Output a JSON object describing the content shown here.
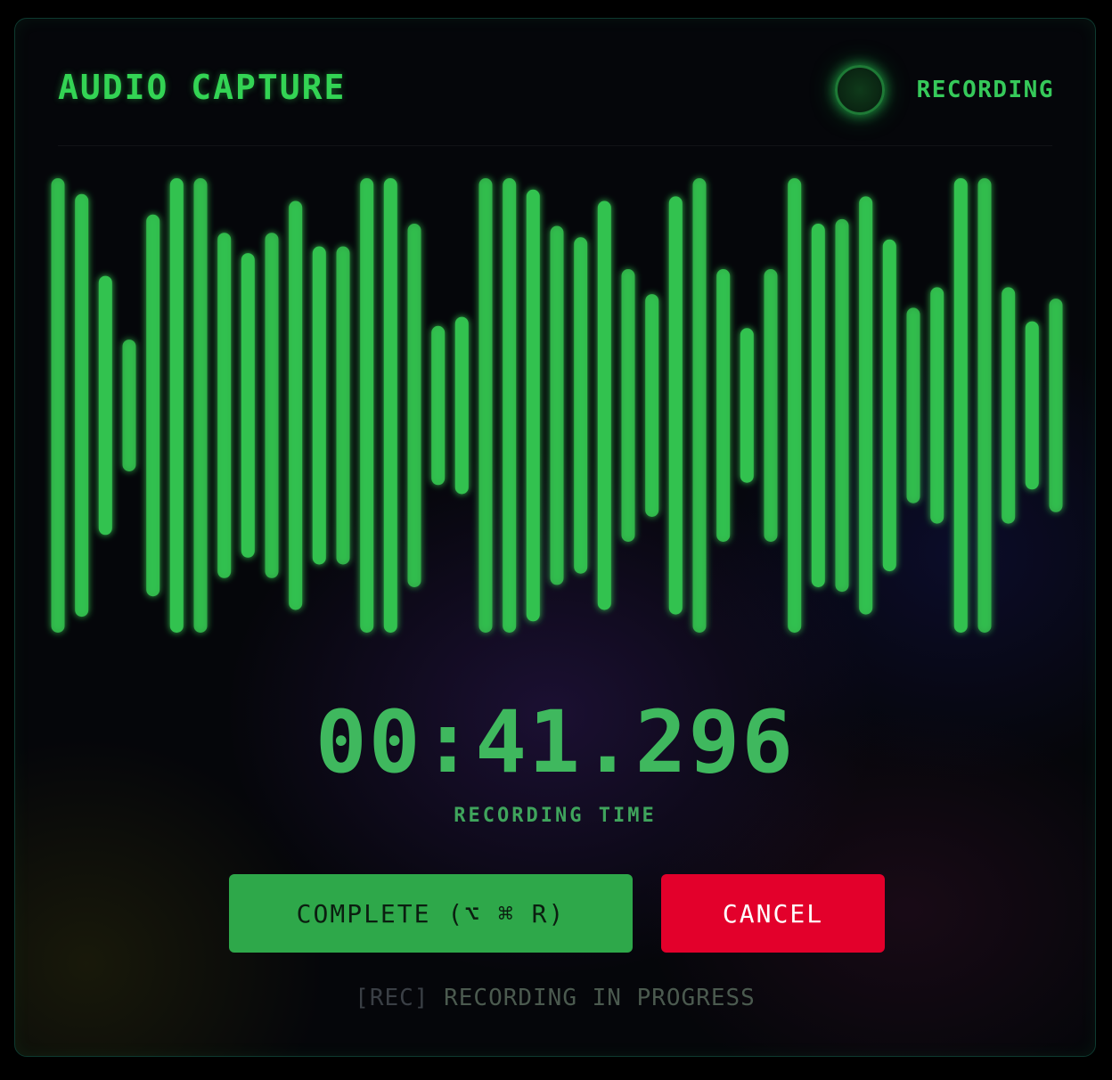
{
  "header": {
    "title": "AUDIO CAPTURE",
    "status_label": "RECORDING"
  },
  "waveform": {
    "color": "#33c24f",
    "bar_levels": [
      1.0,
      0.93,
      0.57,
      0.29,
      0.84,
      1.0,
      1.0,
      0.76,
      0.67,
      0.76,
      0.9,
      0.7,
      0.7,
      1.0,
      1.0,
      0.8,
      0.35,
      0.39,
      1.0,
      1.0,
      0.95,
      0.79,
      0.74,
      0.9,
      0.6,
      0.49,
      0.92,
      1.0,
      0.6,
      0.34,
      0.6,
      1.0,
      0.8,
      0.82,
      0.92,
      0.73,
      0.43,
      0.52,
      1.0,
      1.0,
      0.52,
      0.37,
      0.47
    ]
  },
  "timer": {
    "value": "00:41.296",
    "label": "RECORDING TIME"
  },
  "actions": {
    "complete_label": "COMPLETE (⌥ ⌘ R)",
    "cancel_label": "CANCEL"
  },
  "footer": {
    "tag": "[REC]",
    "text": " RECORDING IN PROGRESS"
  },
  "colors": {
    "accent": "#33d454",
    "complete_button": "#2ea84a",
    "cancel_button": "#e3002b"
  }
}
